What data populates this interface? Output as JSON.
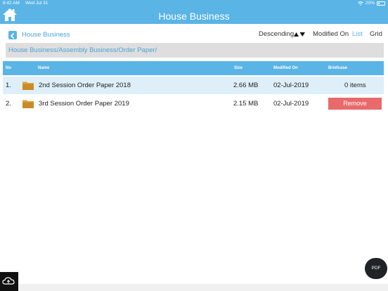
{
  "status_bar": {
    "time": "8:42 AM",
    "date": "Wed Jul 31",
    "battery": "20%"
  },
  "header": {
    "title": "House Business"
  },
  "navigation": {
    "back_label": "House Business",
    "sort_order": "Descending",
    "sort_field": "Modified On",
    "view_list": "List",
    "view_grid": "Grid"
  },
  "path": "House Business/Assembly Business/Order Paper/",
  "table": {
    "columns": [
      "No",
      "Name",
      "Size",
      "Modified On",
      "Briefcase"
    ],
    "rows": [
      {
        "no": "1.",
        "name": "2nd Session Order Paper 2018",
        "size": "2.66 MB",
        "modified": "02-Jul-2019",
        "briefcase": "0 items"
      },
      {
        "no": "2.",
        "name": "3rd Session Order Paper 2019",
        "size": "2.15 MB",
        "modified": "02-Jul-2019",
        "briefcase": "Remove"
      }
    ]
  },
  "fab": {
    "pdf_label": "PDF"
  },
  "colors": {
    "accent": "#5ab4e6",
    "row_highlight": "#deeff9",
    "remove": "#e86a6a",
    "folder": "#e0a23a"
  },
  "icons": [
    "home-icon",
    "wifi-icon",
    "battery-icon",
    "back-chevron-icon",
    "sort-arrows-icon",
    "folder-icon",
    "cloud-upload-icon"
  ]
}
